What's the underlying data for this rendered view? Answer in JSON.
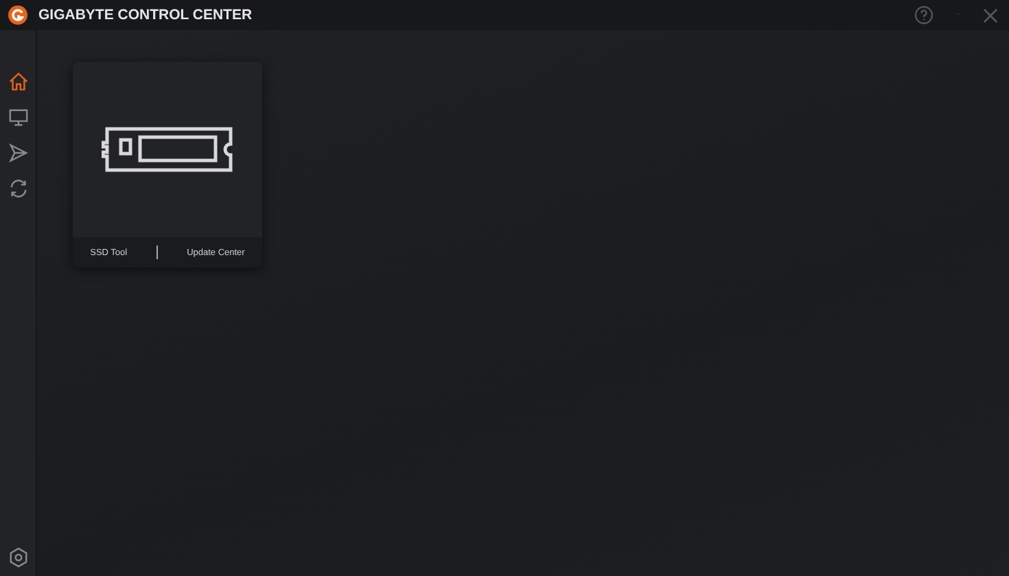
{
  "window": {
    "title": "GIGABYTE CONTROL CENTER"
  },
  "sidebar": {
    "items": [
      {
        "selected": true
      },
      {
        "selected": false
      },
      {
        "selected": false
      },
      {
        "selected": false
      }
    ]
  },
  "card": {
    "actions": [
      "SSD Tool",
      "Update Center"
    ]
  }
}
